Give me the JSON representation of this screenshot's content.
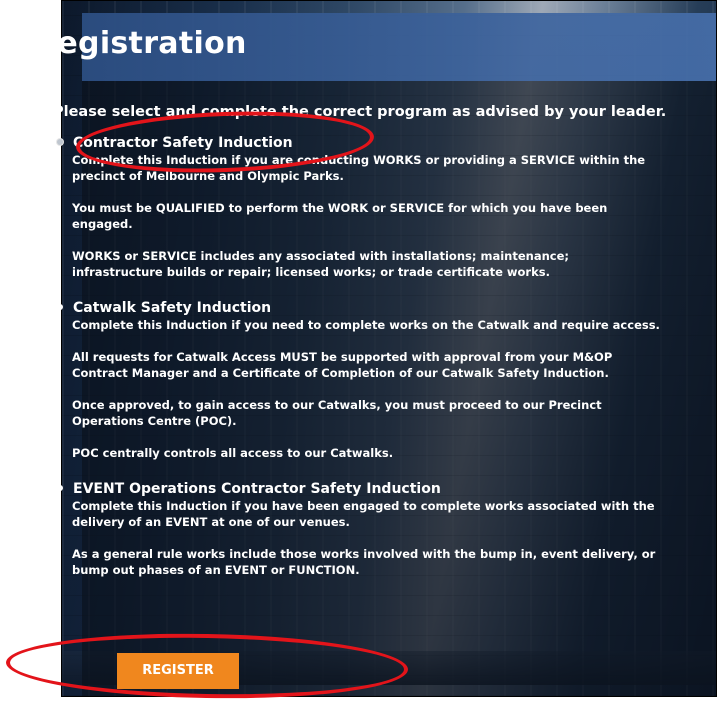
{
  "page": {
    "title": "Registration",
    "intro": "Please select and complete the correct program as advised by your leader."
  },
  "programs": [
    {
      "title": "Contractor Safety Induction",
      "selected": true,
      "paragraphs": [
        "Complete this Induction if you are conducting WORKS or providing a SERVICE within the precinct of Melbourne and Olympic Parks.",
        "You must be QUALIFIED to perform the WORK or SERVICE for which you have been engaged.",
        "WORKS or SERVICE includes any associated with installations; maintenance; infrastructure builds or repair; licensed works; or trade certificate works."
      ]
    },
    {
      "title": "Catwalk Safety Induction",
      "selected": false,
      "paragraphs": [
        "Complete this Induction if you need to complete works on the Catwalk and require access.",
        "All requests for Catwalk Access MUST be supported with approval from your M&OP Contract Manager and a Certificate of Completion of our Catwalk Safety Induction.",
        "Once approved, to gain access to our Catwalks, you must proceed to our Precinct Operations Centre (POC).",
        "POC centrally controls all access to our Catwalks."
      ]
    },
    {
      "title": "EVENT Operations Contractor Safety Induction",
      "selected": false,
      "paragraphs": [
        "Complete this Induction if you have been engaged to complete works associated with the delivery of an EVENT at one of our venues.",
        "As a general rule works include those works involved with the bump in, event delivery, or bump out phases of an EVENT or FUNCTION."
      ]
    }
  ],
  "actions": {
    "register_label": "REGISTER"
  },
  "colors": {
    "header_bg": "#2c4e82",
    "button_bg": "#f0871e",
    "annotation": "#e3141a"
  },
  "icons": {
    "program_bullet": "radio-bullet-icon"
  }
}
